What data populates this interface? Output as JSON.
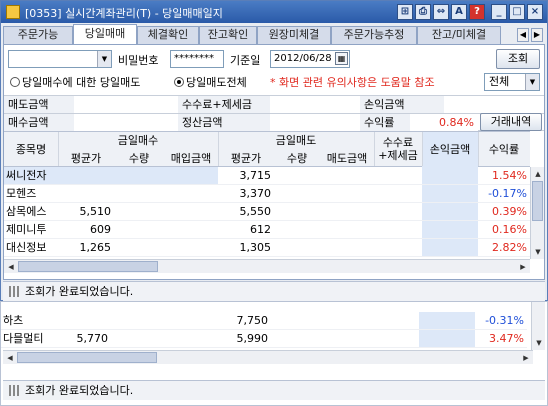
{
  "window": {
    "title": "[0353] 실시간계좌관리(T) - 당일매매일지"
  },
  "tabs": [
    {
      "label": "주문가능"
    },
    {
      "label": "당일매매"
    },
    {
      "label": "체결확인"
    },
    {
      "label": "잔고확인"
    },
    {
      "label": "원장미체결"
    },
    {
      "label": "주문가능추정"
    },
    {
      "label": "잔고/미체결"
    }
  ],
  "filter": {
    "password_label": "비밀번호",
    "password_value": "********",
    "date_label": "기준일",
    "date_value": "2012/06/28",
    "query_button": "조회",
    "radio_buy_sell": "당일매수에 대한 당일매도",
    "radio_all_sell": "당일매도전체",
    "notice": "* 화면 관련 유의사항은 도움말 참조",
    "scope_value": "전체"
  },
  "summary": {
    "sell_amount_label": "매도금액",
    "fee_tax_label": "수수료+제세금",
    "pnl_amount_label": "손익금액",
    "buy_amount_label": "매수금액",
    "settle_amount_label": "정산금액",
    "return_label": "수익률",
    "return_value": "0.84%",
    "history_button": "거래내역"
  },
  "grid": {
    "headers": {
      "name": "종목명",
      "buy_group": "금일매수",
      "sell_group": "금일매도",
      "avg_price": "평균가",
      "qty": "수량",
      "buy_amount": "매입금액",
      "sell_avg_price": "평균가",
      "sell_qty": "수량",
      "sell_amount": "매도금액",
      "fee_tax": "수수료\n+제세금",
      "pnl": "손익금액",
      "return": "수익률"
    },
    "rows": [
      {
        "name": "써니전자",
        "buy_avg": "",
        "sell_avg": "3,715",
        "ret": "1.54%",
        "neg": false
      },
      {
        "name": "모헨즈",
        "buy_avg": "",
        "sell_avg": "3,370",
        "ret": "-0.17%",
        "neg": true
      },
      {
        "name": "삼목에스",
        "buy_avg": "5,510",
        "sell_avg": "5,550",
        "ret": "0.39%",
        "neg": false
      },
      {
        "name": "제미니투",
        "buy_avg": "609",
        "sell_avg": "612",
        "ret": "0.16%",
        "neg": false
      },
      {
        "name": "대신정보",
        "buy_avg": "1,265",
        "sell_avg": "1,305",
        "ret": "2.82%",
        "neg": false
      }
    ]
  },
  "status": {
    "message": "조회가 완료되었습니다."
  },
  "ghost": {
    "rows": [
      {
        "name": "하츠",
        "buy_avg": "",
        "sell_avg": "7,750",
        "ret": "-0.31%"
      },
      {
        "name": "다믈멀티",
        "buy_avg": "5,770",
        "sell_avg": "5,990",
        "ret": "3.47%"
      }
    ],
    "status_message": "조회가 완료되었습니다."
  },
  "colors": {
    "title_bar": "#2a5aa8",
    "positive": "#e0281e",
    "negative": "#1f4fd8",
    "notice": "#e0281e",
    "selected_cell": "#dde8f8"
  },
  "icons": [
    "app-icon",
    "minimize-icon",
    "maximize-icon",
    "close-icon",
    "help-icon",
    "calendar-icon",
    "chevron-down-icon",
    "chevron-left-icon",
    "chevron-right-icon"
  ]
}
